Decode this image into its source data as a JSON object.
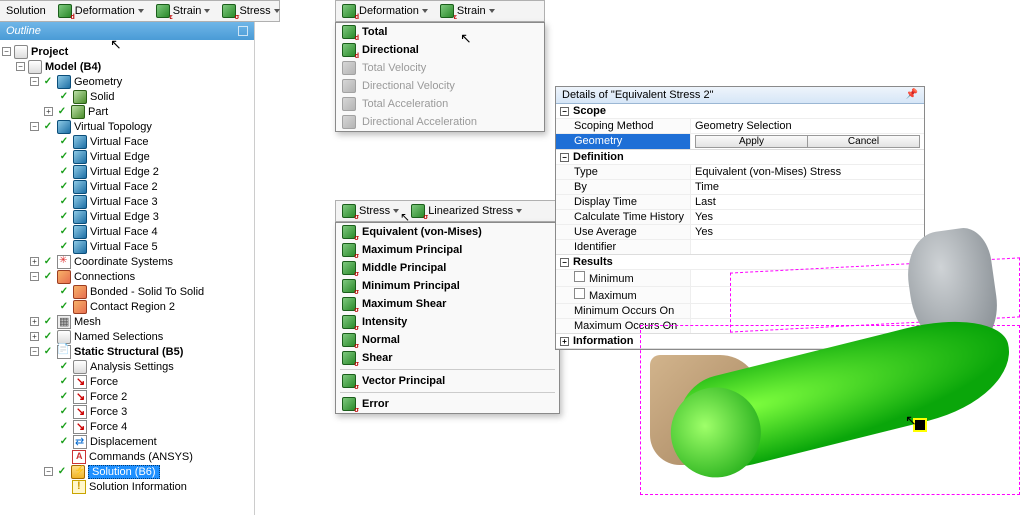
{
  "toolbar_top": {
    "solution": "Solution",
    "deformation": "Deformation",
    "strain": "Strain",
    "stress": "Stress"
  },
  "toolbar_def": {
    "deformation": "Deformation",
    "strain": "Strain"
  },
  "outline": {
    "title": "Outline",
    "project": "Project",
    "model": "Model (B4)",
    "geometry": "Geometry",
    "solid": "Solid",
    "part": "Part",
    "vtop": "Virtual Topology",
    "vface": "Virtual Face",
    "vedge": "Virtual Edge",
    "vedge2": "Virtual Edge 2",
    "vface2": "Virtual Face 2",
    "vface3": "Virtual Face 3",
    "vedge3": "Virtual Edge 3",
    "vface4": "Virtual Face 4",
    "vface5": "Virtual Face 5",
    "coord": "Coordinate Systems",
    "conn": "Connections",
    "bond": "Bonded - Solid To Solid",
    "cr2": "Contact Region 2",
    "mesh": "Mesh",
    "nsel": "Named Selections",
    "ss": "Static Structural (B5)",
    "aset": "Analysis Settings",
    "f1": "Force",
    "f2": "Force 2",
    "f3": "Force 3",
    "f4": "Force 4",
    "disp": "Displacement",
    "cmd": "Commands (ANSYS)",
    "sol": "Solution (B6)",
    "sinfo": "Solution Information"
  },
  "def_menu": {
    "total": "Total",
    "dir": "Directional",
    "tv": "Total Velocity",
    "dv": "Directional Velocity",
    "ta": "Total Acceleration",
    "da": "Directional Acceleration"
  },
  "stress_tb": {
    "stress": "Stress",
    "lin": "Linearized Stress"
  },
  "stress_menu": {
    "eq": "Equivalent (von-Mises)",
    "maxp": "Maximum Principal",
    "midp": "Middle Principal",
    "minp": "Minimum Principal",
    "maxs": "Maximum Shear",
    "int": "Intensity",
    "norm": "Normal",
    "shear": "Shear",
    "vec": "Vector Principal",
    "err": "Error"
  },
  "details": {
    "title": "Details of \"Equivalent Stress 2\"",
    "scope": "Scope",
    "scope_method_k": "Scoping Method",
    "scope_method_v": "Geometry Selection",
    "geom_k": "Geometry",
    "apply": "Apply",
    "cancel": "Cancel",
    "def": "Definition",
    "type_k": "Type",
    "type_v": "Equivalent (von-Mises) Stress",
    "by_k": "By",
    "by_v": "Time",
    "dtime_k": "Display Time",
    "dtime_v": "Last",
    "cth_k": "Calculate Time History",
    "cth_v": "Yes",
    "avg_k": "Use Average",
    "avg_v": "Yes",
    "ident_k": "Identifier",
    "res": "Results",
    "min_k": "Minimum",
    "max_k": "Maximum",
    "mino_k": "Minimum Occurs On",
    "maxo_k": "Maximum Occurs On",
    "info": "Information"
  }
}
